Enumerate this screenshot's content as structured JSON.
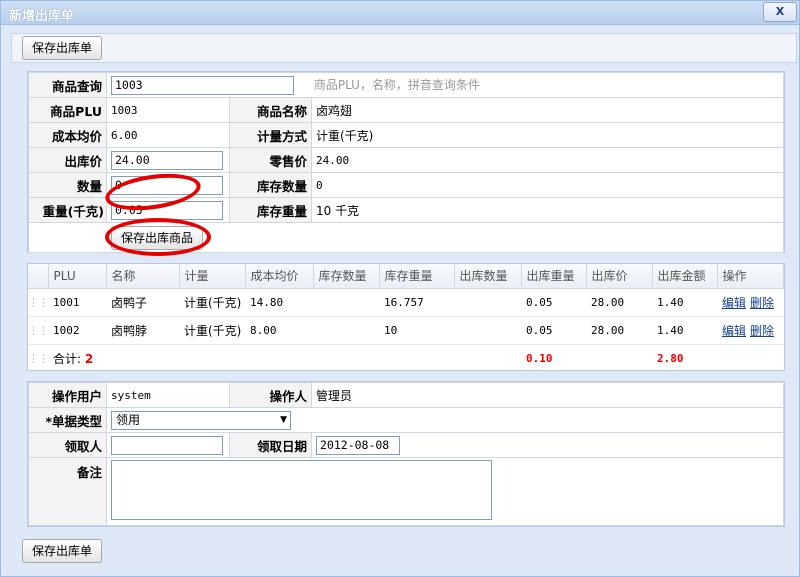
{
  "window": {
    "title": "新增出库单",
    "close_label": "X"
  },
  "toolbar": {
    "save_label": "保存出库单"
  },
  "form": {
    "query": {
      "label": "商品查询",
      "value": "1003",
      "hint": "商品PLU，名称，拼音查询条件"
    },
    "plu": {
      "label": "商品PLU",
      "value": "1003"
    },
    "name": {
      "label": "商品名称",
      "value": "卤鸡翅"
    },
    "avg_cost": {
      "label": "成本均价",
      "value": "6.00"
    },
    "measure": {
      "label": "计量方式",
      "value": "计重(千克)"
    },
    "out_price": {
      "label": "出库价",
      "value": "24.00"
    },
    "retail_price": {
      "label": "零售价",
      "value": "24.00"
    },
    "quantity": {
      "label": "数量",
      "value": "0"
    },
    "stock_qty": {
      "label": "库存数量",
      "value": "0"
    },
    "weight": {
      "label": "重量(千克)",
      "value": "0.05"
    },
    "stock_weight": {
      "label": "库存重量",
      "value": "10 千克"
    },
    "save_item_label": "保存出库商品"
  },
  "grid": {
    "columns": [
      "PLU",
      "名称",
      "计量",
      "成本均价",
      "库存数量",
      "库存重量",
      "出库数量",
      "出库重量",
      "出库价",
      "出库金额",
      "操作"
    ],
    "rows": [
      {
        "plu": "1001",
        "name": "卤鸭子",
        "measure": "计重(千克)",
        "avg_cost": "14.80",
        "stock_qty": "",
        "stock_weight": "16.757",
        "out_qty": "",
        "out_weight": "0.05",
        "out_price": "28.00",
        "amount": "1.40",
        "edit": "编辑",
        "delete": "删除"
      },
      {
        "plu": "1002",
        "name": "卤鸭脖",
        "measure": "计重(千克)",
        "avg_cost": "8.00",
        "stock_qty": "",
        "stock_weight": "10",
        "out_qty": "",
        "out_weight": "0.05",
        "out_price": "28.00",
        "amount": "1.40",
        "edit": "编辑",
        "delete": "删除"
      }
    ],
    "summary": {
      "label": "合计:",
      "count": "2",
      "total_weight": "0.10",
      "total_amount": "2.80"
    }
  },
  "footer_form": {
    "operator_user": {
      "label": "操作用户",
      "value": "system"
    },
    "operator": {
      "label": "操作人",
      "value": "管理员"
    },
    "doc_type": {
      "label": "*单据类型",
      "value": "领用"
    },
    "receiver": {
      "label": "领取人",
      "value": ""
    },
    "receive_date": {
      "label": "领取日期",
      "value": "2012-08-08"
    },
    "remark": {
      "label": "备注",
      "value": ""
    }
  },
  "annotation_color": "#e60000"
}
